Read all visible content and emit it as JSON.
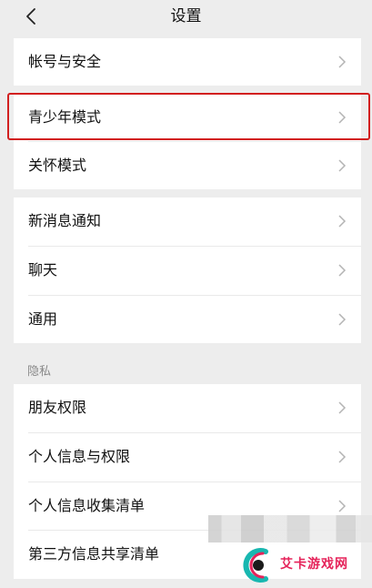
{
  "header": {
    "title": "设置"
  },
  "group1": {
    "items": [
      {
        "label": "帐号与安全"
      }
    ]
  },
  "group2": {
    "items": [
      {
        "label": "青少年模式"
      },
      {
        "label": "关怀模式"
      }
    ]
  },
  "group3": {
    "items": [
      {
        "label": "新消息通知"
      },
      {
        "label": "聊天"
      },
      {
        "label": "通用"
      }
    ]
  },
  "privacy": {
    "caption": "隐私",
    "items": [
      {
        "label": "朋友权限"
      },
      {
        "label": "个人信息与权限"
      },
      {
        "label": "个人信息收集清单"
      },
      {
        "label": "第三方信息共享清单"
      }
    ]
  },
  "watermark": {
    "text": "艾卡游戏网"
  },
  "colors": {
    "highlight": "#d21f1f",
    "watermark": "#e5235a"
  }
}
